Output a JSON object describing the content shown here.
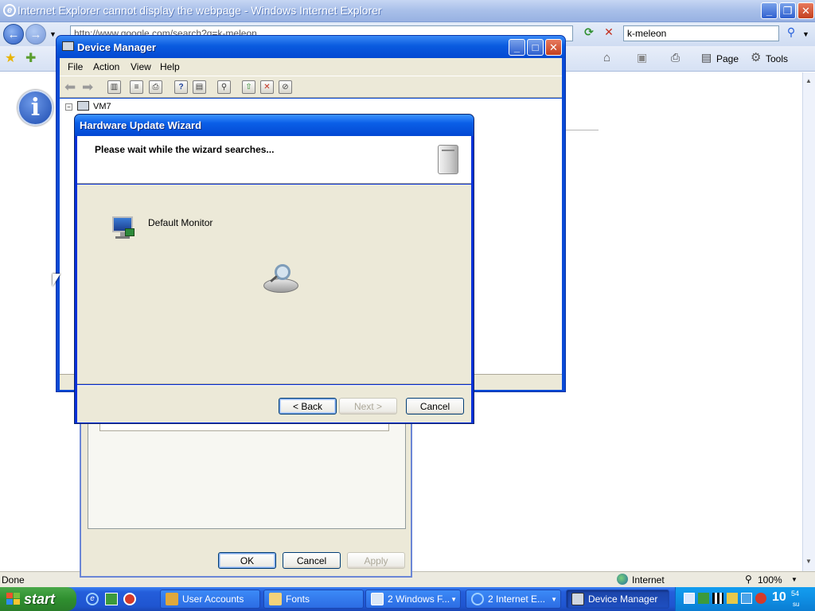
{
  "ie": {
    "title": "Internet Explorer cannot display the webpage - Windows Internet Explorer",
    "address": "http://www.google.com/search?q=k-meleon",
    "search_value": "k-meleon",
    "command_bar": {
      "page": "Page",
      "tools": "Tools"
    },
    "status_text": "Done",
    "zone": "Internet",
    "zoom": "100%"
  },
  "device_manager": {
    "title": "Device Manager",
    "menu": [
      "File",
      "Action",
      "View",
      "Help"
    ],
    "tree_root": "VM7"
  },
  "wizard": {
    "title": "Hardware Update Wizard",
    "heading": "Please wait while the wizard searches...",
    "device_name": "Default Monitor",
    "buttons": {
      "back": "< Back",
      "next": "Next >",
      "cancel": "Cancel"
    }
  },
  "properties_dialog": {
    "buttons": {
      "ok": "OK",
      "cancel": "Cancel",
      "apply": "Apply"
    }
  },
  "taskbar": {
    "start": "start",
    "tasks": [
      "User Accounts",
      "Fonts",
      "2 Windows F...",
      "2 Internet E...",
      "Device Manager"
    ],
    "clock_hour": "10",
    "clock_min": "54",
    "clock_day": "su"
  },
  "colors": {
    "xp_blue": "#0a5fe7",
    "start_green": "#2f8f2f",
    "dialog_bg": "#ece9d8"
  }
}
